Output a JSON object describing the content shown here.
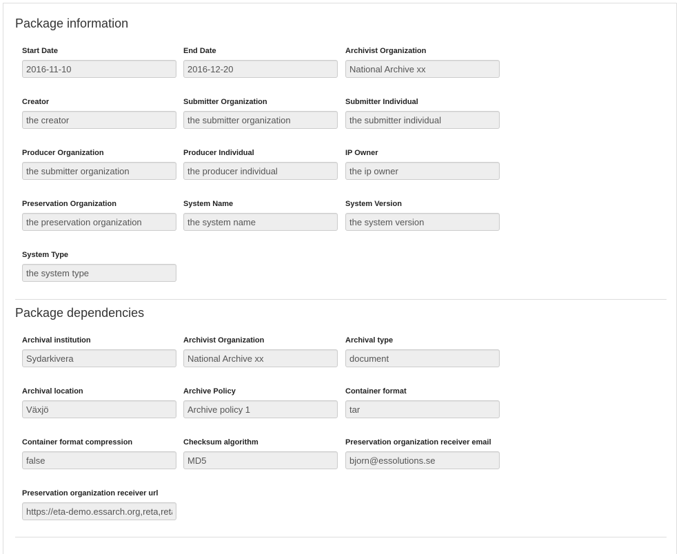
{
  "package_information": {
    "title": "Package information",
    "fields": [
      {
        "label": "Start Date",
        "value": "2016-11-10"
      },
      {
        "label": "End Date",
        "value": "2016-12-20"
      },
      {
        "label": "Archivist Organization",
        "value": "National Archive xx"
      },
      {
        "label": "Creator",
        "value": "the creator"
      },
      {
        "label": "Submitter Organization",
        "value": "the submitter organization"
      },
      {
        "label": "Submitter Individual",
        "value": "the submitter individual"
      },
      {
        "label": "Producer Organization",
        "value": "the submitter organization"
      },
      {
        "label": "Producer Individual",
        "value": "the producer individual"
      },
      {
        "label": "IP Owner",
        "value": "the ip owner"
      },
      {
        "label": "Preservation Organization",
        "value": "the preservation organization"
      },
      {
        "label": "System Name",
        "value": "the system name"
      },
      {
        "label": "System Version",
        "value": "the system version"
      },
      {
        "label": "System Type",
        "value": "the system type"
      }
    ]
  },
  "package_dependencies": {
    "title": "Package dependencies",
    "fields": [
      {
        "label": "Archival institution",
        "value": "Sydarkivera"
      },
      {
        "label": "Archivist Organization",
        "value": "National Archive xx"
      },
      {
        "label": "Archival type",
        "value": "document"
      },
      {
        "label": "Archival location",
        "value": "Växjö"
      },
      {
        "label": "Archive Policy",
        "value": "Archive policy 1"
      },
      {
        "label": "Container format",
        "value": "tar"
      },
      {
        "label": "Container format compression",
        "value": "false"
      },
      {
        "label": "Checksum algorithm",
        "value": "MD5"
      },
      {
        "label": "Preservation organization receiver email",
        "value": "bjorn@essolutions.se"
      },
      {
        "label": "Preservation organization receiver url",
        "value": "https://eta-demo.essarch.org,reta,reta"
      }
    ]
  }
}
